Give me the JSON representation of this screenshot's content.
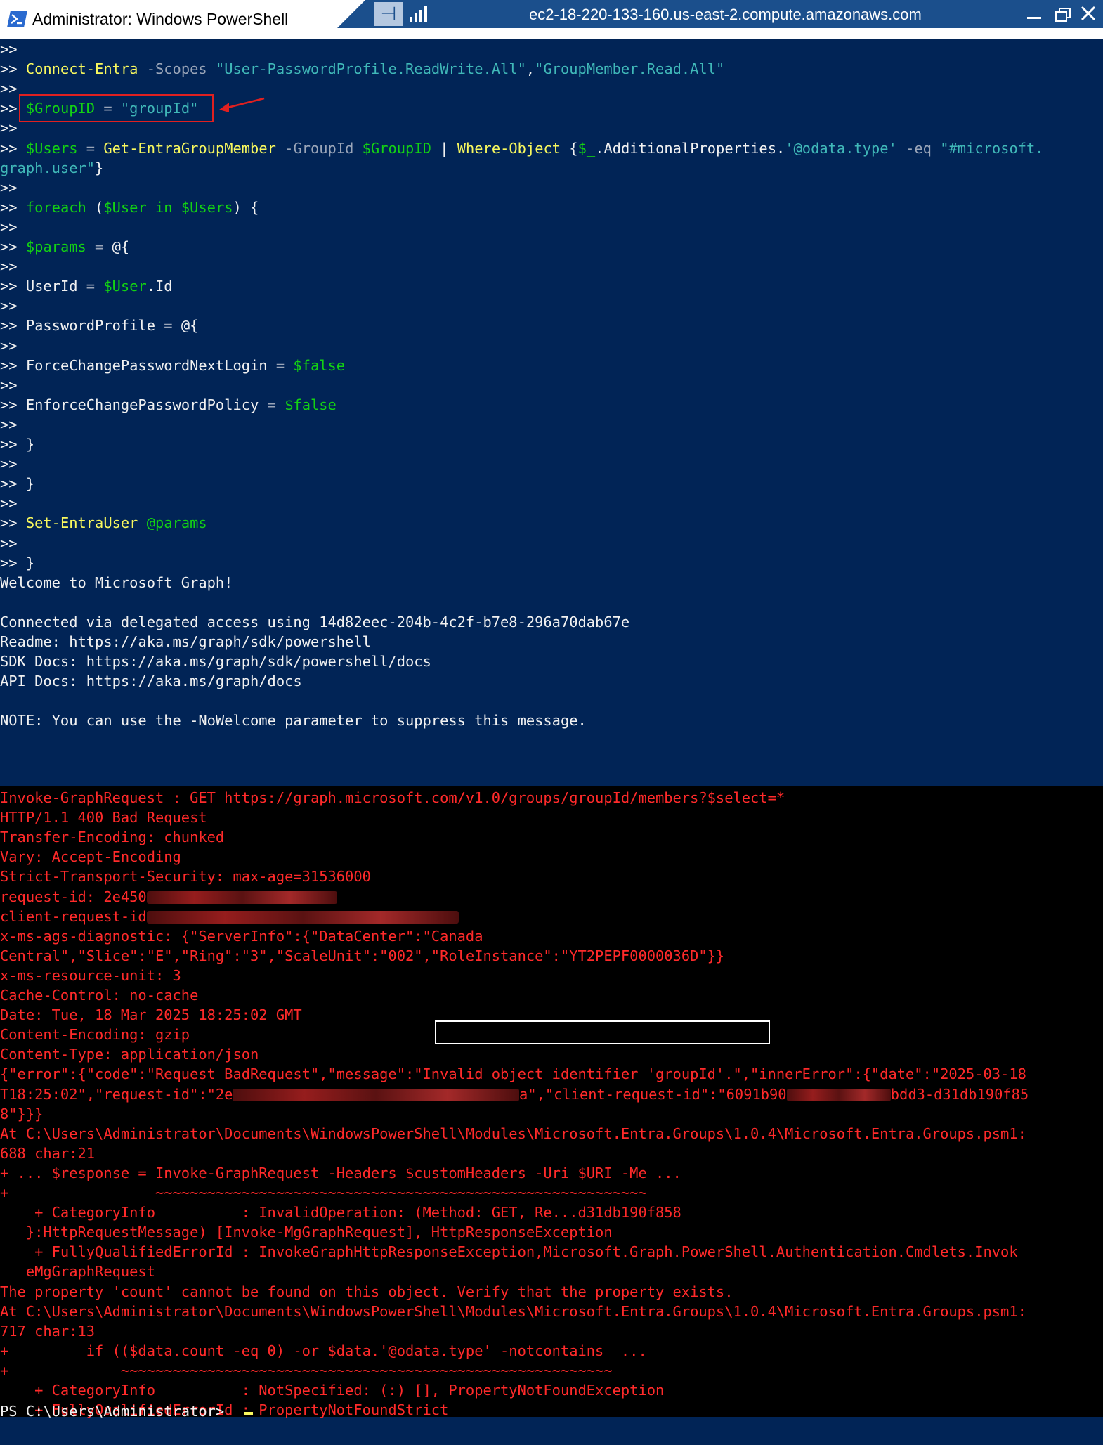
{
  "window": {
    "title": "Administrator: Windows PowerShell",
    "rdp_host": "ec2-18-220-133-160.us-east-2.compute.amazonaws.com",
    "rdp_pin_glyph": "⊣",
    "colors": {
      "console_bg": "#012456",
      "error_bg": "#000000",
      "error_text": "#ff2a2a",
      "rdp_bar": "#1b4f8c"
    }
  },
  "script_lines": [
    {
      "segments": [
        {
          "t": ">>",
          "c": "w"
        }
      ]
    },
    {
      "segments": [
        {
          "t": ">> ",
          "c": "w"
        },
        {
          "t": "Connect-Entra",
          "c": "y"
        },
        {
          "t": " -Scopes ",
          "c": "sg"
        },
        {
          "t": "\"User-PasswordProfile.ReadWrite.All\"",
          "c": "str"
        },
        {
          "t": ",",
          "c": "w"
        },
        {
          "t": "\"GroupMember.Read.All\"",
          "c": "str"
        }
      ]
    },
    {
      "segments": [
        {
          "t": ">>",
          "c": "w"
        }
      ]
    },
    {
      "segments": [
        {
          "t": ">> ",
          "c": "w"
        },
        {
          "t": "$GroupID",
          "c": "g"
        },
        {
          "t": " = ",
          "c": "op"
        },
        {
          "t": "\"groupId\"",
          "c": "str"
        }
      ]
    },
    {
      "segments": [
        {
          "t": ">>",
          "c": "w"
        }
      ]
    },
    {
      "segments": [
        {
          "t": ">> ",
          "c": "w"
        },
        {
          "t": "$Users",
          "c": "g"
        },
        {
          "t": " = ",
          "c": "op"
        },
        {
          "t": "Get-EntraGroupMember",
          "c": "y"
        },
        {
          "t": " -GroupId ",
          "c": "sg"
        },
        {
          "t": "$GroupID",
          "c": "g"
        },
        {
          "t": " | ",
          "c": "w"
        },
        {
          "t": "Where-Object",
          "c": "y"
        },
        {
          "t": " {",
          "c": "w"
        },
        {
          "t": "$_",
          "c": "g"
        },
        {
          "t": ".AdditionalProperties.",
          "c": "w"
        },
        {
          "t": "'@odata.type'",
          "c": "str"
        },
        {
          "t": " -eq ",
          "c": "sg"
        },
        {
          "t": "\"#microsoft.",
          "c": "str"
        }
      ]
    },
    {
      "segments": [
        {
          "t": "graph.user\"",
          "c": "str"
        },
        {
          "t": "}",
          "c": "w"
        }
      ]
    },
    {
      "segments": [
        {
          "t": ">>",
          "c": "w"
        }
      ]
    },
    {
      "segments": [
        {
          "t": ">> ",
          "c": "w"
        },
        {
          "t": "foreach",
          "c": "g"
        },
        {
          "t": " (",
          "c": "w"
        },
        {
          "t": "$User",
          "c": "g"
        },
        {
          "t": " in ",
          "c": "g"
        },
        {
          "t": "$Users",
          "c": "g"
        },
        {
          "t": ") {",
          "c": "w"
        }
      ]
    },
    {
      "segments": [
        {
          "t": ">>",
          "c": "w"
        }
      ]
    },
    {
      "segments": [
        {
          "t": ">> ",
          "c": "w"
        },
        {
          "t": "$params",
          "c": "g"
        },
        {
          "t": " = ",
          "c": "op"
        },
        {
          "t": "@{",
          "c": "w"
        }
      ]
    },
    {
      "segments": [
        {
          "t": ">>",
          "c": "w"
        }
      ]
    },
    {
      "segments": [
        {
          "t": ">> ",
          "c": "w"
        },
        {
          "t": "UserId",
          "c": "w"
        },
        {
          "t": " = ",
          "c": "op"
        },
        {
          "t": "$User",
          "c": "g"
        },
        {
          "t": ".Id",
          "c": "w"
        }
      ]
    },
    {
      "segments": [
        {
          "t": ">>",
          "c": "w"
        }
      ]
    },
    {
      "segments": [
        {
          "t": ">> ",
          "c": "w"
        },
        {
          "t": "PasswordProfile",
          "c": "w"
        },
        {
          "t": " = ",
          "c": "op"
        },
        {
          "t": "@{",
          "c": "w"
        }
      ]
    },
    {
      "segments": [
        {
          "t": ">>",
          "c": "w"
        }
      ]
    },
    {
      "segments": [
        {
          "t": ">> ",
          "c": "w"
        },
        {
          "t": "ForceChangePasswordNextLogin",
          "c": "w"
        },
        {
          "t": " = ",
          "c": "op"
        },
        {
          "t": "$false",
          "c": "g"
        }
      ]
    },
    {
      "segments": [
        {
          "t": ">>",
          "c": "w"
        }
      ]
    },
    {
      "segments": [
        {
          "t": ">> ",
          "c": "w"
        },
        {
          "t": "EnforceChangePasswordPolicy",
          "c": "w"
        },
        {
          "t": " = ",
          "c": "op"
        },
        {
          "t": "$false",
          "c": "g"
        }
      ]
    },
    {
      "segments": [
        {
          "t": ">>",
          "c": "w"
        }
      ]
    },
    {
      "segments": [
        {
          "t": ">> }",
          "c": "w"
        }
      ]
    },
    {
      "segments": [
        {
          "t": ">>",
          "c": "w"
        }
      ]
    },
    {
      "segments": [
        {
          "t": ">> }",
          "c": "w"
        }
      ]
    },
    {
      "segments": [
        {
          "t": ">>",
          "c": "w"
        }
      ]
    },
    {
      "segments": [
        {
          "t": ">> ",
          "c": "w"
        },
        {
          "t": "Set-EntraUser",
          "c": "y"
        },
        {
          "t": " @params",
          "c": "g"
        }
      ]
    },
    {
      "segments": [
        {
          "t": ">>",
          "c": "w"
        }
      ]
    },
    {
      "segments": [
        {
          "t": ">> }",
          "c": "w"
        }
      ]
    },
    {
      "segments": [
        {
          "t": "Welcome to Microsoft Graph!",
          "c": "w"
        }
      ]
    },
    {
      "segments": [
        {
          "t": "",
          "c": "w"
        }
      ]
    },
    {
      "segments": [
        {
          "t": "Connected via delegated access using 14d82eec-204b-4c2f-b7e8-296a70dab67e",
          "c": "w"
        }
      ]
    },
    {
      "segments": [
        {
          "t": "Readme: https://aka.ms/graph/sdk/powershell",
          "c": "w"
        }
      ]
    },
    {
      "segments": [
        {
          "t": "SDK Docs: https://aka.ms/graph/sdk/powershell/docs",
          "c": "w"
        }
      ]
    },
    {
      "segments": [
        {
          "t": "API Docs: https://aka.ms/graph/docs",
          "c": "w"
        }
      ]
    },
    {
      "segments": [
        {
          "t": "",
          "c": "w"
        }
      ]
    },
    {
      "segments": [
        {
          "t": "NOTE: You can use the -NoWelcome parameter to suppress this message.",
          "c": "w"
        }
      ]
    }
  ],
  "error_lines": [
    {
      "segments": [
        {
          "t": "Invoke-GraphRequest : GET https://graph.microsoft.com/v1.0/groups/groupId/members?$select=*"
        }
      ]
    },
    {
      "segments": [
        {
          "t": "HTTP/1.1 400 Bad Request"
        }
      ]
    },
    {
      "segments": [
        {
          "t": "Transfer-Encoding: chunked"
        }
      ]
    },
    {
      "segments": [
        {
          "t": "Vary: Accept-Encoding"
        }
      ]
    },
    {
      "segments": [
        {
          "t": "Strict-Transport-Security: max-age=31536000"
        }
      ]
    },
    {
      "segments": [
        {
          "t": "request-id: 2e450"
        },
        {
          "t": "",
          "blur": 22
        }
      ]
    },
    {
      "segments": [
        {
          "t": "client-request-id"
        },
        {
          "t": "",
          "blur": 36
        }
      ]
    },
    {
      "segments": [
        {
          "t": "x-ms-ags-diagnostic: {\"ServerInfo\":{\"DataCenter\":\"Canada"
        }
      ]
    },
    {
      "segments": [
        {
          "t": "Central\",\"Slice\":\"E\",\"Ring\":\"3\",\"ScaleUnit\":\"002\",\"RoleInstance\":\"YT2PEPF0000036D\"}}"
        }
      ]
    },
    {
      "segments": [
        {
          "t": "x-ms-resource-unit: 3"
        }
      ]
    },
    {
      "segments": [
        {
          "t": "Cache-Control: no-cache"
        }
      ]
    },
    {
      "segments": [
        {
          "t": "Date: Tue, 18 Mar 2025 18:25:02 GMT"
        }
      ]
    },
    {
      "segments": [
        {
          "t": "Content-Encoding: gzip"
        }
      ]
    },
    {
      "segments": [
        {
          "t": "Content-Type: application/json"
        }
      ]
    },
    {
      "segments": [
        {
          "t": "{\"error\":{\"code\":\"Request_BadRequest\",\"message\":\"Invalid object identifier 'groupId'.\",\"innerError\":{\"date\":\"2025-03-18"
        }
      ]
    },
    {
      "segments": [
        {
          "t": "T18:25:02\",\"request-id\":\"2e"
        },
        {
          "t": "",
          "blur": 33
        },
        {
          "t": "a\",\"client-request-id\":\"6091b90"
        },
        {
          "t": "",
          "blur": 12
        },
        {
          "t": "bdd3-d31db190f85"
        }
      ]
    },
    {
      "segments": [
        {
          "t": "8\"}}}"
        }
      ]
    },
    {
      "segments": [
        {
          "t": "At C:\\Users\\Administrator\\Documents\\WindowsPowerShell\\Modules\\Microsoft.Entra.Groups\\1.0.4\\Microsoft.Entra.Groups.psm1:"
        }
      ]
    },
    {
      "segments": [
        {
          "t": "688 char:21"
        }
      ]
    },
    {
      "segments": [
        {
          "t": "+ ... $response = Invoke-GraphRequest -Headers $customHeaders -Uri $URI -Me ..."
        }
      ]
    },
    {
      "segments": [
        {
          "t": "+                 ~~~~~~~~~~~~~~~~~~~~~~~~~~~~~~~~~~~~~~~~~~~~~~~~~~~~~~~~~"
        }
      ]
    },
    {
      "segments": [
        {
          "t": "    + CategoryInfo          : InvalidOperation: (Method: GET, Re...d31db190f858"
        }
      ]
    },
    {
      "segments": [
        {
          "t": "   }:HttpRequestMessage) [Invoke-MgGraphRequest], HttpResponseException"
        }
      ]
    },
    {
      "segments": [
        {
          "t": "    + FullyQualifiedErrorId : InvokeGraphHttpResponseException,Microsoft.Graph.PowerShell.Authentication.Cmdlets.Invok"
        }
      ]
    },
    {
      "segments": [
        {
          "t": "   eMgGraphRequest"
        }
      ]
    },
    {
      "segments": [
        {
          "t": "The property 'count' cannot be found on this object. Verify that the property exists."
        }
      ]
    },
    {
      "segments": [
        {
          "t": "At C:\\Users\\Administrator\\Documents\\WindowsPowerShell\\Modules\\Microsoft.Entra.Groups\\1.0.4\\Microsoft.Entra.Groups.psm1:"
        }
      ]
    },
    {
      "segments": [
        {
          "t": "717 char:13"
        }
      ]
    },
    {
      "segments": [
        {
          "t": "+         if (($data.count -eq 0) -or $data.'@odata.type' -notcontains  ..."
        }
      ]
    },
    {
      "segments": [
        {
          "t": "+             ~~~~~~~~~~~~~~~~~~~~~~~~~~~~~~~~~~~~~~~~~~~~~~~~~~~~~~~~~"
        }
      ]
    },
    {
      "segments": [
        {
          "t": "    + CategoryInfo          : NotSpecified: (:) [], PropertyNotFoundException"
        }
      ]
    },
    {
      "segments": [
        {
          "t": "    + FullyQualifiedErrorId : PropertyNotFoundStrict"
        }
      ]
    }
  ],
  "prompt": "PS C:\\Users\\Administrator> "
}
